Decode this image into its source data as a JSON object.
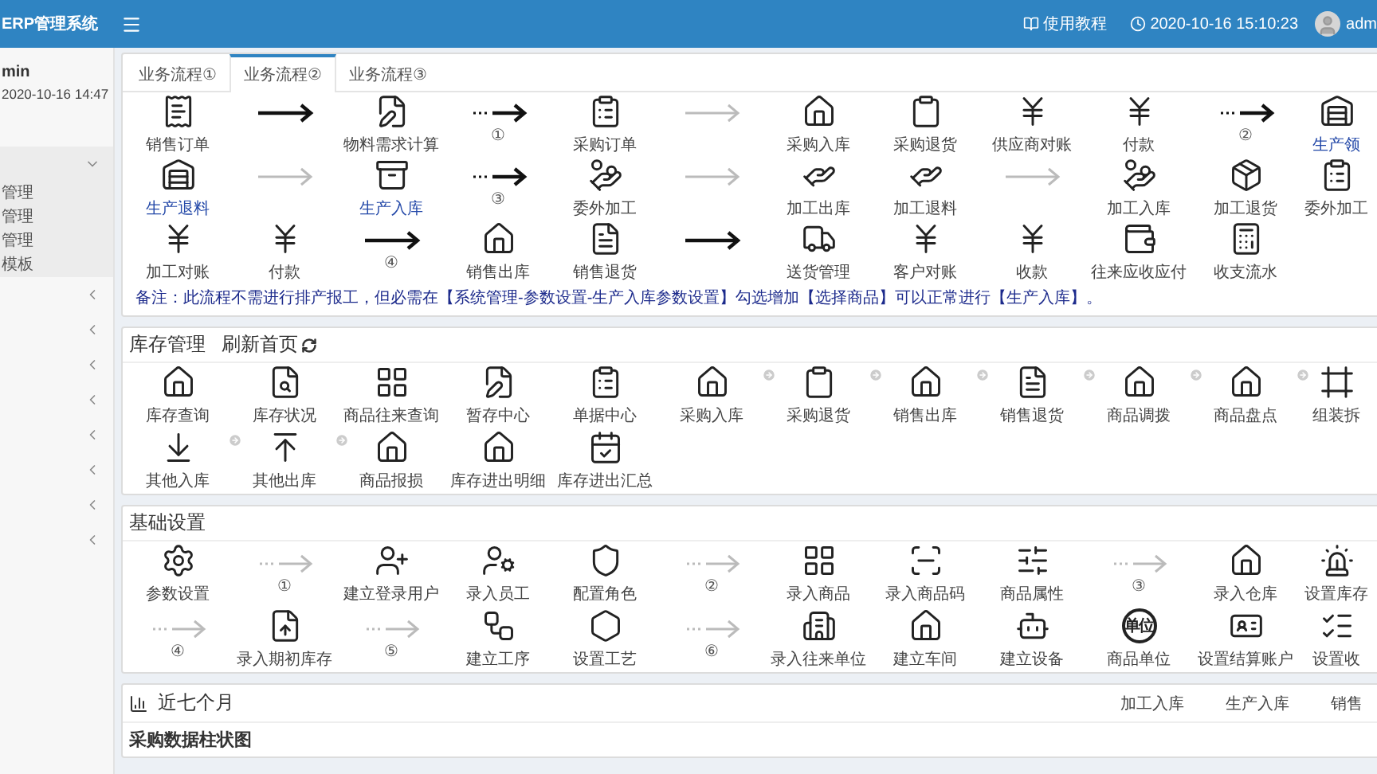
{
  "header": {
    "brand": "ERP管理系统",
    "help": "使用教程",
    "datetime": "2020-10-16 15:10:23",
    "user": "adm"
  },
  "sidebar": {
    "user": "min",
    "login_time": "2020-10-16 14:47",
    "menu": [
      {
        "expanded": true,
        "children": [
          "管理",
          "管理",
          "管理",
          "模板"
        ]
      },
      {
        "expanded": false
      },
      {
        "expanded": false
      },
      {
        "expanded": false
      },
      {
        "expanded": false
      },
      {
        "expanded": false
      },
      {
        "expanded": false
      },
      {
        "expanded": false
      },
      {
        "expanded": false
      }
    ]
  },
  "process": {
    "tabs": [
      {
        "label": "业务流程①",
        "selected": false
      },
      {
        "label": "业务流程②",
        "selected": true
      },
      {
        "label": "业务流程③",
        "selected": false
      }
    ],
    "rows": [
      [
        {
          "kind": "node",
          "label": "销售订单",
          "highlight": false
        },
        {
          "kind": "arrow"
        },
        {
          "kind": "node",
          "label": "物料需求计算",
          "highlight": false
        },
        {
          "kind": "dotted-arrow",
          "label": "①"
        },
        {
          "kind": "node",
          "label": "采购订单",
          "highlight": false
        },
        {
          "kind": "grey-arrow"
        },
        {
          "kind": "node",
          "label": "采购入库",
          "highlight": false
        },
        {
          "kind": "node",
          "label": "采购退货",
          "highlight": false
        },
        {
          "kind": "node",
          "label": "供应商对账",
          "highlight": false
        },
        {
          "kind": "node",
          "label": "付款",
          "highlight": false
        },
        {
          "kind": "dotted-arrow",
          "label": "②"
        },
        {
          "kind": "node",
          "label": "生产领",
          "highlight": true
        }
      ],
      [
        {
          "kind": "node",
          "label": "生产退料",
          "highlight": true
        },
        {
          "kind": "grey-arrow"
        },
        {
          "kind": "node",
          "label": "生产入库",
          "highlight": true
        },
        {
          "kind": "dotted-arrow",
          "label": "③"
        },
        {
          "kind": "node",
          "label": "委外加工",
          "highlight": false
        },
        {
          "kind": "grey-arrow"
        },
        {
          "kind": "node",
          "label": "加工出库",
          "highlight": false
        },
        {
          "kind": "node",
          "label": "加工退料",
          "highlight": false
        },
        {
          "kind": "grey-arrow"
        },
        {
          "kind": "node",
          "label": "加工入库",
          "highlight": false
        },
        {
          "kind": "node",
          "label": "加工退货",
          "highlight": false
        },
        {
          "kind": "node",
          "label": "委外加工",
          "highlight": false
        }
      ],
      [
        {
          "kind": "node",
          "label": "加工对账",
          "highlight": false
        },
        {
          "kind": "node",
          "label": "付款",
          "highlight": false
        },
        {
          "kind": "arrow",
          "label": "④"
        },
        {
          "kind": "node",
          "label": "销售出库",
          "highlight": false
        },
        {
          "kind": "node",
          "label": "销售退货",
          "highlight": false
        },
        {
          "kind": "arrow"
        },
        {
          "kind": "node",
          "label": "送货管理",
          "highlight": false
        },
        {
          "kind": "node",
          "label": "客户对账",
          "highlight": false
        },
        {
          "kind": "node",
          "label": "收款",
          "highlight": false
        },
        {
          "kind": "node",
          "label": "往来应收应付",
          "highlight": false
        },
        {
          "kind": "node",
          "label": "收支流水",
          "highlight": false
        }
      ]
    ],
    "note": "备注：此流程不需进行排产报工，但必需在【系统管理-参数设置-生产入库参数设置】勾选增加【选择商品】可以正常进行【生产入库】。"
  },
  "stock": {
    "title": "库存管理",
    "refresh": "刷新首页",
    "rows": [
      [
        {
          "kind": "node",
          "label": "库存查询",
          "link": false
        },
        {
          "kind": "node",
          "label": "库存状况",
          "link": false
        },
        {
          "kind": "node",
          "label": "商品往来查询",
          "link": false
        },
        {
          "kind": "node",
          "label": "暂存中心",
          "link": false
        },
        {
          "kind": "node",
          "label": "单据中心",
          "link": false
        },
        {
          "kind": "node",
          "label": "采购入库",
          "link": true
        },
        {
          "kind": "node",
          "label": "采购退货",
          "link": true
        },
        {
          "kind": "node",
          "label": "销售出库",
          "link": true
        },
        {
          "kind": "node",
          "label": "销售退货",
          "link": true
        },
        {
          "kind": "node",
          "label": "商品调拨",
          "link": true
        },
        {
          "kind": "node",
          "label": "商品盘点",
          "link": true
        },
        {
          "kind": "node",
          "label": "组装拆",
          "link": false
        }
      ],
      [
        {
          "kind": "node",
          "label": "其他入库",
          "link": true
        },
        {
          "kind": "node",
          "label": "其他出库",
          "link": true
        },
        {
          "kind": "node",
          "label": "商品报损",
          "link": false
        },
        {
          "kind": "node",
          "label": "库存进出明细",
          "link": false
        },
        {
          "kind": "node",
          "label": "库存进出汇总",
          "link": false
        }
      ]
    ]
  },
  "basics": {
    "title": "基础设置",
    "rows": [
      [
        {
          "kind": "node",
          "label": "参数设置"
        },
        {
          "kind": "dotted-grey-arrow",
          "label": "①"
        },
        {
          "kind": "node",
          "label": "建立登录用户"
        },
        {
          "kind": "node",
          "label": "录入员工"
        },
        {
          "kind": "node",
          "label": "配置角色"
        },
        {
          "kind": "dotted-grey-arrow",
          "label": "②"
        },
        {
          "kind": "node",
          "label": "录入商品"
        },
        {
          "kind": "node",
          "label": "录入商品码"
        },
        {
          "kind": "node",
          "label": "商品属性"
        },
        {
          "kind": "dotted-grey-arrow",
          "label": "③"
        },
        {
          "kind": "node",
          "label": "录入仓库"
        },
        {
          "kind": "node",
          "label": "设置库存"
        }
      ],
      [
        {
          "kind": "dotted-grey-arrow",
          "label": "④"
        },
        {
          "kind": "node",
          "label": "录入期初库存"
        },
        {
          "kind": "dotted-grey-arrow",
          "label": "⑤"
        },
        {
          "kind": "node",
          "label": "建立工序"
        },
        {
          "kind": "node",
          "label": "设置工艺"
        },
        {
          "kind": "dotted-grey-arrow",
          "label": "⑥"
        },
        {
          "kind": "node",
          "label": "录入往来单位"
        },
        {
          "kind": "node",
          "label": "建立车间"
        },
        {
          "kind": "node",
          "label": "建立设备"
        },
        {
          "kind": "node",
          "label": "商品单位",
          "badge": "单位"
        },
        {
          "kind": "node",
          "label": "设置结算账户"
        },
        {
          "kind": "node",
          "label": "设置收"
        }
      ]
    ]
  },
  "chart": {
    "title": "近七个月",
    "tabs": [
      "加工入库",
      "生产入库",
      "销售"
    ],
    "subtitle": "采购数据柱状图"
  }
}
